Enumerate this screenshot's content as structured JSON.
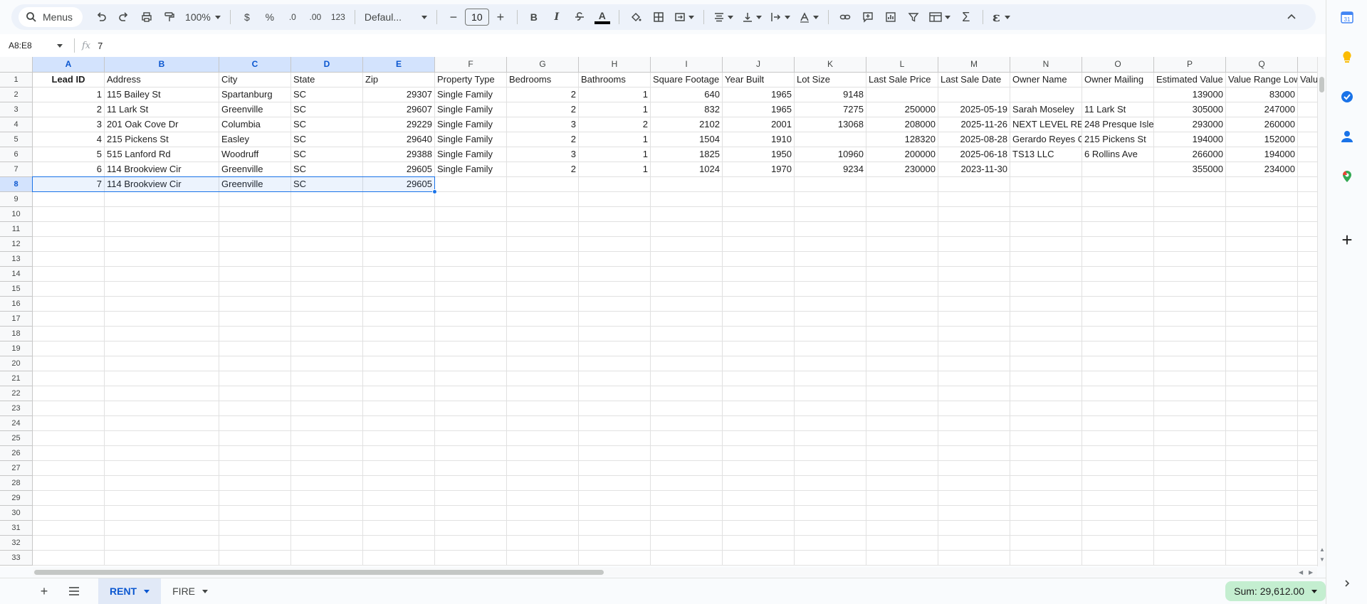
{
  "toolbar": {
    "search_label": "Menus",
    "zoom": "100%",
    "currency": "$",
    "percent": "%",
    "dec_decrease": ".0",
    "dec_increase": ".00",
    "number_format": "123",
    "font": "Defaul...",
    "font_size": "10",
    "bold": "B",
    "italic": "I",
    "text_color": "A",
    "minus": "−",
    "plus": "+"
  },
  "formula_bar": {
    "name_box": "A8:E8",
    "fx": "fx",
    "value": "7"
  },
  "grid": {
    "columns": [
      "A",
      "B",
      "C",
      "D",
      "E",
      "F",
      "G",
      "H",
      "I",
      "J",
      "K",
      "L",
      "M",
      "N",
      "O",
      "P",
      "Q"
    ],
    "selected_columns": [
      "A",
      "B",
      "C",
      "D",
      "E"
    ],
    "row_numbers": [
      "1",
      "2",
      "3",
      "4",
      "5",
      "6",
      "7",
      "8",
      "9",
      "10",
      "11",
      "12",
      "13",
      "14",
      "15",
      "16",
      "17",
      "18",
      "19",
      "20",
      "21",
      "22",
      "23",
      "24",
      "25",
      "26",
      "27",
      "28",
      "29",
      "30",
      "31",
      "32",
      "33"
    ],
    "selected_row": "8",
    "headers": [
      "Lead ID",
      "Address",
      "City",
      "State",
      "Zip",
      "Property Type",
      "Bedrooms",
      "Bathrooms",
      "Square Footage",
      "Year Built",
      "Lot Size",
      "Last Sale Price",
      "Last Sale Date",
      "Owner Name",
      "Owner Mailing",
      "Estimated Value",
      "Value Range Low",
      "Value"
    ],
    "rows": [
      [
        "1",
        "115 Bailey St",
        "Spartanburg",
        "SC",
        "29307",
        "Single Family",
        "2",
        "1",
        "640",
        "1965",
        "9148",
        "",
        "",
        "",
        "",
        "139000",
        "83000"
      ],
      [
        "2",
        "11 Lark St",
        "Greenville",
        "SC",
        "29607",
        "Single Family",
        "2",
        "1",
        "832",
        "1965",
        "7275",
        "250000",
        "2025-05-19",
        "Sarah Moseley",
        "11 Lark St",
        "305000",
        "247000"
      ],
      [
        "3",
        "201 Oak Cove Dr",
        "Columbia",
        "SC",
        "29229",
        "Single Family",
        "3",
        "2",
        "2102",
        "2001",
        "13068",
        "208000",
        "2025-11-26",
        "NEXT LEVEL RENT",
        "248 Presque Isle",
        "293000",
        "260000"
      ],
      [
        "4",
        "215 Pickens St",
        "Easley",
        "SC",
        "29640",
        "Single Family",
        "2",
        "1",
        "1504",
        "1910",
        "",
        "128320",
        "2025-08-28",
        "Gerardo Reyes Cruz",
        "215 Pickens St",
        "194000",
        "152000"
      ],
      [
        "5",
        "515 Lanford Rd",
        "Woodruff",
        "SC",
        "29388",
        "Single Family",
        "3",
        "1",
        "1825",
        "1950",
        "10960",
        "200000",
        "2025-06-18",
        "TS13 LLC",
        "6 Rollins Ave",
        "266000",
        "194000"
      ],
      [
        "6",
        "114 Brookview Cir",
        "Greenville",
        "SC",
        "29605",
        "Single Family",
        "2",
        "1",
        "1024",
        "1970",
        "9234",
        "230000",
        "2023-11-30",
        "",
        "",
        "355000",
        "234000"
      ],
      [
        "7",
        "114 Brookview Cir",
        "Greenville",
        "SC",
        "29605",
        "",
        "",
        "",
        "",
        "",
        "",
        "",
        "",
        "",
        "",
        "",
        ""
      ]
    ]
  },
  "sheets": [
    {
      "label": "RENT",
      "active": true
    },
    {
      "label": "FIRE",
      "active": false
    }
  ],
  "status": {
    "sum": "Sum: 29,612.00"
  },
  "colors": {
    "accent": "#0b57d0",
    "selection": "#1a73e8",
    "sum_bg": "#c4eed0"
  }
}
